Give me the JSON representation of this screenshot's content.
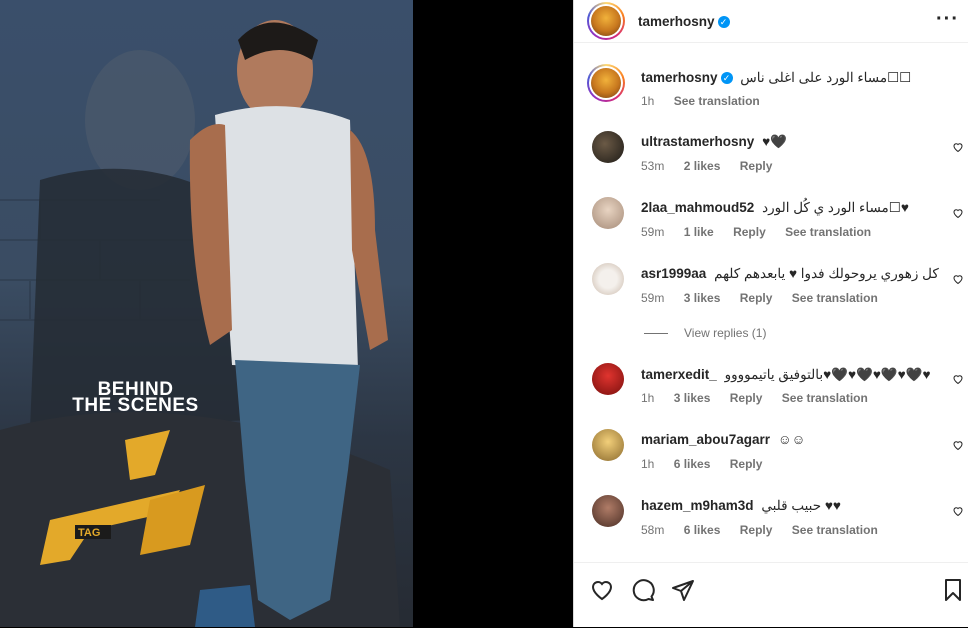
{
  "post": {
    "author": "tamerhosny",
    "verified": true,
    "caption": "مساء الورد على اغلى ناس",
    "caption_emoji": "☐☐",
    "time": "1h",
    "see_translation": "See translation",
    "media": {
      "overlay_title_line1": "BEHIND",
      "overlay_title_line2": "THE SCENES",
      "logo_text": "TAG"
    }
  },
  "comments": [
    {
      "user": "ultrastamerhosny",
      "text": "♥🖤",
      "time": "53m",
      "likes": "2 likes",
      "reply": "Reply",
      "translate": ""
    },
    {
      "user": "2laa_mahmoud52",
      "text": "مساء الورد ي كُل الورد☐♥",
      "time": "59m",
      "likes": "1 like",
      "reply": "Reply",
      "translate": "See translation"
    },
    {
      "user": "asr1999aa",
      "text": "كل زهوري يروحولك فدوا ♥ يابعدهم كلهم",
      "time": "59m",
      "likes": "3 likes",
      "reply": "Reply",
      "translate": "See translation"
    },
    {
      "user": "tamerxedit_",
      "text": "بالتوفيق ياتيموووو♥🖤♥🖤♥🖤♥🖤♥",
      "time": "1h",
      "likes": "3 likes",
      "reply": "Reply",
      "translate": "See translation"
    },
    {
      "user": "mariam_abou7agarr",
      "text": "☺☺",
      "time": "1h",
      "likes": "6 likes",
      "reply": "Reply",
      "translate": ""
    },
    {
      "user": "hazem_m9ham3d",
      "text": "حبيب قلبي ♥♥",
      "time": "58m",
      "likes": "6 likes",
      "reply": "Reply",
      "translate": "See translation"
    }
  ],
  "view_replies": "View replies (1)",
  "colors": {
    "accent": "#0095f6",
    "muted": "#737373",
    "gold": "#e3a92a"
  }
}
